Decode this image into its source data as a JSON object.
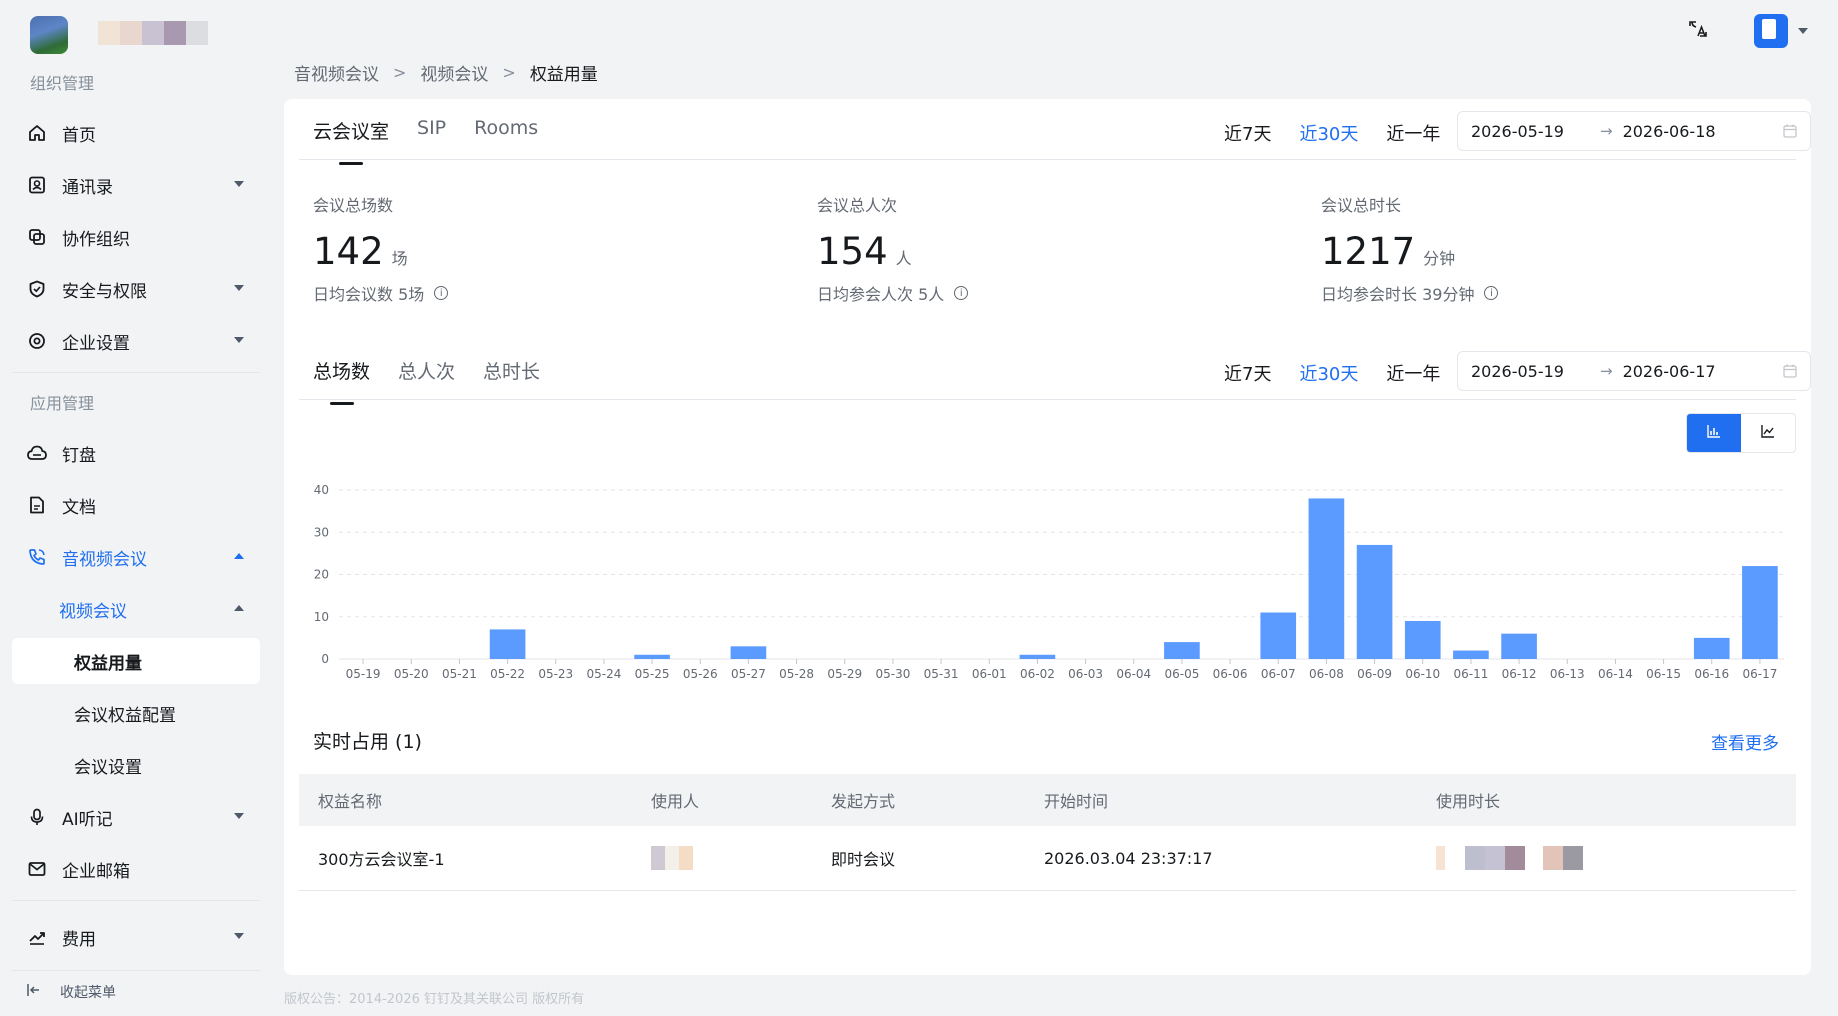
{
  "sidebar": {
    "section_org": "组织管理",
    "section_app": "应用管理",
    "items": {
      "home": "首页",
      "contacts": "通讯录",
      "collab": "协作组织",
      "security": "安全与权限",
      "enterprise": "企业设置",
      "drive": "钉盘",
      "docs": "文档",
      "av": "音视频会议",
      "video": "视频会议",
      "rights_usage": "权益用量",
      "rights_config": "会议权益配置",
      "meeting_settings": "会议设置",
      "ai_notes": "AI听记",
      "mail": "企业邮箱",
      "fees": "费用"
    },
    "collapse": "收起菜单"
  },
  "breadcrumb": [
    "音视频会议",
    "视频会议",
    "权益用量"
  ],
  "top_tabs": [
    "云会议室",
    "SIP",
    "Rooms"
  ],
  "ranges": [
    "近7天",
    "近30天",
    "近一年"
  ],
  "top_range": {
    "start": "2026-05-19",
    "end": "2026-06-18"
  },
  "stats": [
    {
      "title": "会议总场数",
      "value": "142",
      "unit": "场",
      "sub": "日均会议数 5场"
    },
    {
      "title": "会议总人次",
      "value": "154",
      "unit": "人",
      "sub": "日均参会人次 5人"
    },
    {
      "title": "会议总时长",
      "value": "1217",
      "unit": "分钟",
      "sub": "日均参会时长 39分钟"
    }
  ],
  "chart_tabs": [
    "总场数",
    "总人次",
    "总时长"
  ],
  "chart_range": {
    "start": "2026-05-19",
    "end": "2026-06-17"
  },
  "chart_data": {
    "type": "bar",
    "categories": [
      "05-19",
      "05-20",
      "05-21",
      "05-22",
      "05-23",
      "05-24",
      "05-25",
      "05-26",
      "05-27",
      "05-28",
      "05-29",
      "05-30",
      "05-31",
      "06-01",
      "06-02",
      "06-03",
      "06-04",
      "06-05",
      "06-06",
      "06-07",
      "06-08",
      "06-09",
      "06-10",
      "06-11",
      "06-12",
      "06-13",
      "06-14",
      "06-15",
      "06-16",
      "06-17"
    ],
    "values": [
      0,
      0,
      0,
      7,
      0,
      0,
      1,
      0,
      3,
      0,
      0,
      0,
      0,
      0,
      1,
      0,
      0,
      4,
      0,
      11,
      38,
      27,
      9,
      2,
      6,
      0,
      0,
      0,
      5,
      22
    ],
    "ylim": [
      0,
      40
    ],
    "yticks": [
      0,
      10,
      20,
      30,
      40
    ],
    "grid": true,
    "color": "#5b9bff"
  },
  "realtime": {
    "title": "实时占用 (1)",
    "more": "查看更多",
    "columns": [
      "权益名称",
      "使用人",
      "发起方式",
      "开始时间",
      "使用时长"
    ],
    "rows": [
      {
        "name": "300方云会议室-1",
        "method": "即时会议",
        "start": "2026.03.04 23:37:17"
      }
    ]
  },
  "footer": "版权公告：2014-2026 钉钉及其关联公司 版权所有",
  "colors": {
    "accent": "#1f6ff0",
    "bar": "#5b9bff"
  }
}
